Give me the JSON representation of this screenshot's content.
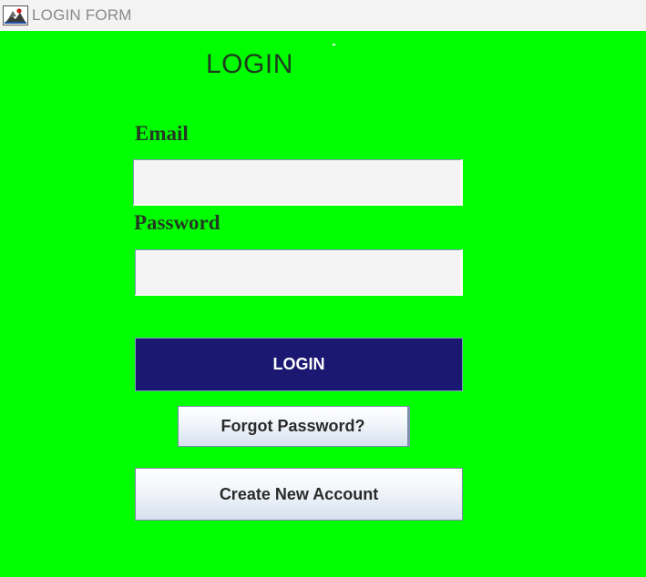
{
  "window": {
    "title": "LOGIN FORM",
    "icon": "java-app-icon"
  },
  "form": {
    "heading": "LOGIN",
    "email": {
      "label": "Email",
      "value": "",
      "placeholder": ""
    },
    "password": {
      "label": "Password",
      "value": "",
      "placeholder": ""
    },
    "buttons": {
      "login": "LOGIN",
      "forgot_password": "Forgot Password?",
      "create_account": "Create New Account"
    }
  },
  "colors": {
    "background": "#00ff00",
    "titlebar": "#f3f3f3",
    "login_button": "#1a1870",
    "input_background": "#f4f4f4"
  }
}
